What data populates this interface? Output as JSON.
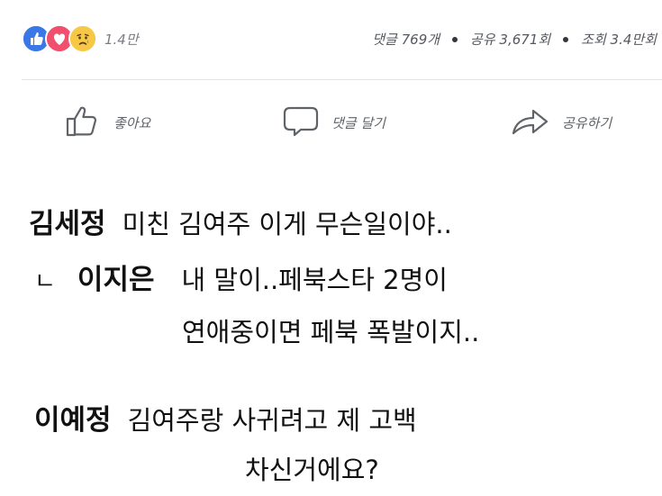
{
  "stats": {
    "reaction_count": "1.4만",
    "comments": "댓글 769개",
    "shares": "공유 3,671회",
    "views": "조회 3.4만회"
  },
  "colors": {
    "like": "#3b78e7",
    "love": "#f0506e",
    "sad": "#f7c846",
    "divider": "#e1e3e6",
    "action_text": "#606368"
  },
  "actions": {
    "like_label": "좋아요",
    "comment_label": "댓글 달기",
    "share_label": "공유하기"
  },
  "comments": [
    {
      "name": "김세정",
      "text": "미친 김여주 이게 무슨일이야.."
    },
    {
      "reply_mark": "ㄴ",
      "name": "이지은",
      "text": "내 말이..페북스타 2명이",
      "text_cont": "연애중이면 페북 폭발이지.."
    },
    {
      "name": "이예정",
      "text": "김여주랑 사귀려고 제 고백",
      "text_cont": "차신거에요?"
    }
  ],
  "icons": {
    "like": "thumbs-up-icon",
    "love": "heart-icon",
    "sad": "sad-face-icon",
    "like_action": "thumbs-up-outline-icon",
    "comment_action": "speech-bubble-icon",
    "share_action": "share-arrow-icon"
  }
}
